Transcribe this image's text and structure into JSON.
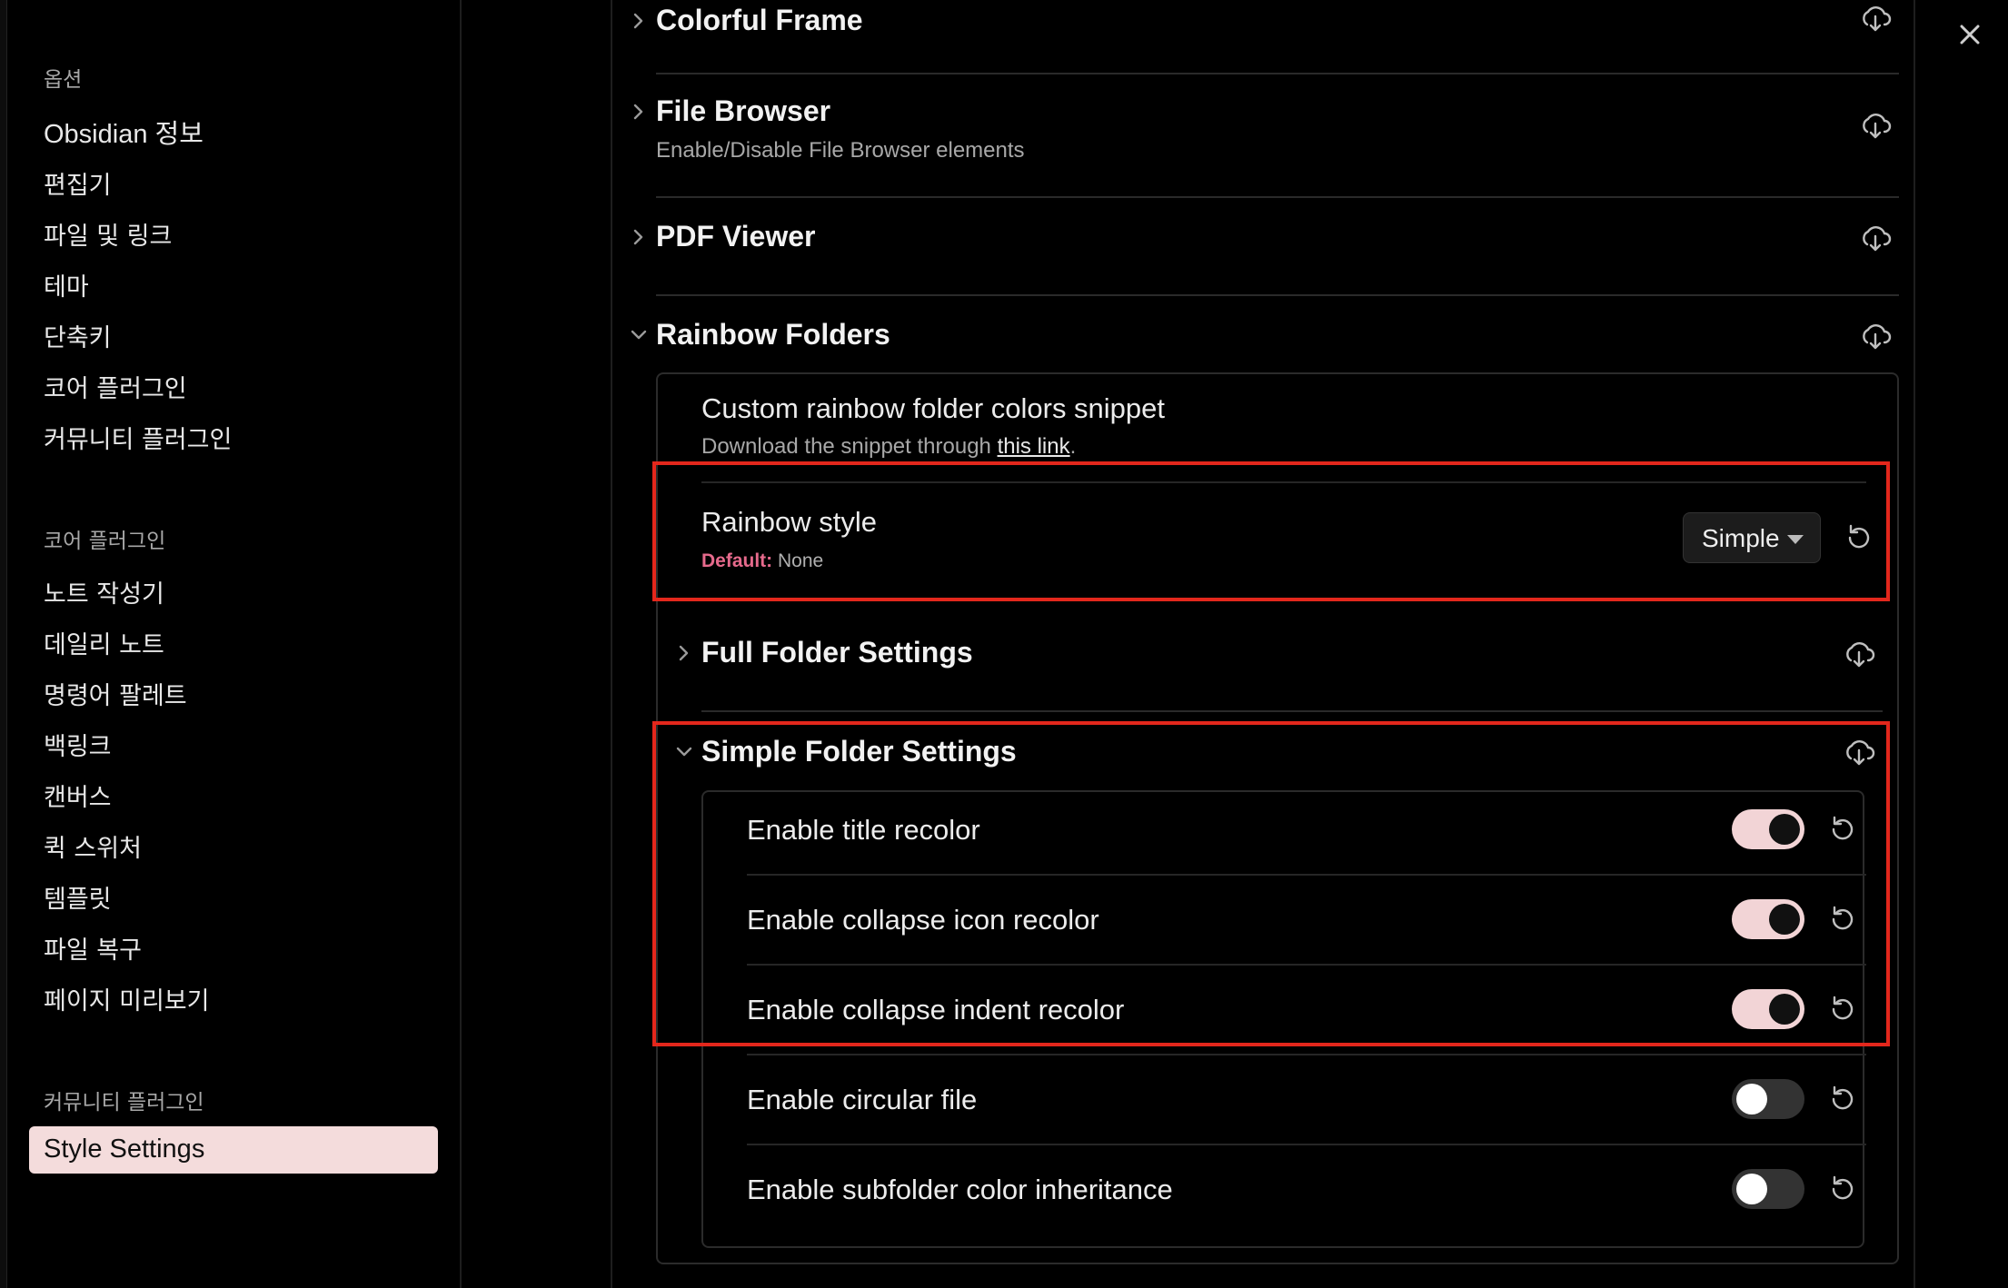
{
  "sidebar": {
    "groups": [
      {
        "title": "옵션",
        "items": [
          "Obsidian 정보",
          "편집기",
          "파일 및 링크",
          "테마",
          "단축키",
          "코어 플러그인",
          "커뮤니티 플러그인"
        ]
      },
      {
        "title": "코어 플러그인",
        "items": [
          "노트 작성기",
          "데일리 노트",
          "명령어 팔레트",
          "백링크",
          "캔버스",
          "퀵 스위처",
          "템플릿",
          "파일 복구",
          "페이지 미리보기"
        ]
      },
      {
        "title": "커뮤니티 플러그인",
        "items": [
          "Style Settings"
        ]
      }
    ],
    "active_item": "Style Settings",
    "active_color": "#f4dcdc"
  },
  "sections": {
    "colorful_frame": {
      "title": "Colorful Frame"
    },
    "file_browser": {
      "title": "File Browser",
      "description": "Enable/Disable File Browser elements"
    },
    "pdf_viewer": {
      "title": "PDF Viewer"
    },
    "rainbow_folders": {
      "title": "Rainbow Folders"
    }
  },
  "rainbow": {
    "snippet": {
      "title": "Custom rainbow folder colors snippet",
      "desc_prefix": "Download the snippet through ",
      "link_text": "this link",
      "desc_suffix": "."
    },
    "style": {
      "label": "Rainbow style",
      "default_label": "Default:",
      "default_value": "None",
      "selected": "Simple"
    },
    "full_folder": {
      "title": "Full Folder Settings"
    },
    "simple_folder": {
      "title": "Simple Folder Settings",
      "toggles": [
        {
          "label": "Enable title recolor",
          "on": true
        },
        {
          "label": "Enable collapse icon recolor",
          "on": true
        },
        {
          "label": "Enable collapse indent recolor",
          "on": true
        },
        {
          "label": "Enable circular file",
          "on": false
        },
        {
          "label": "Enable subfolder color inheritance",
          "on": false
        }
      ]
    }
  },
  "colors": {
    "highlight": "#e3271c",
    "toggle_on": "#f2d4d6",
    "default_label": "#e66a8c"
  },
  "icons": {
    "close": "close-icon",
    "download": "cloud-download-icon",
    "reset": "reset-icon",
    "chevron_right": "chevron-right-icon",
    "chevron_down": "chevron-down-icon"
  }
}
